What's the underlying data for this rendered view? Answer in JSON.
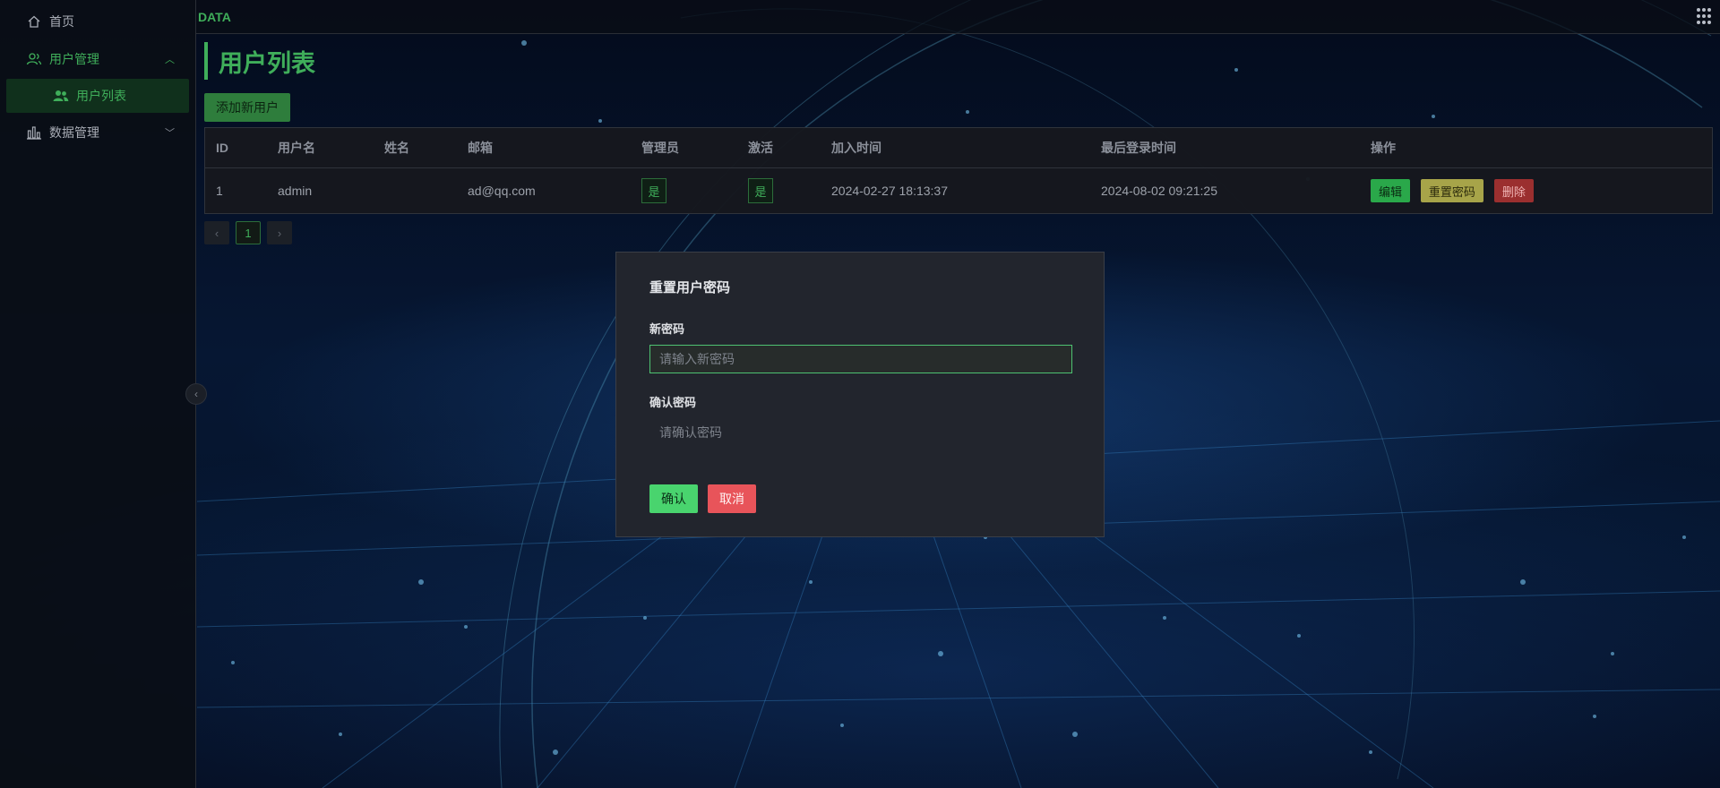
{
  "brand": "DATA",
  "sidebar": {
    "items": [
      {
        "label": "首页",
        "icon": "home-icon"
      },
      {
        "label": "用户管理",
        "icon": "user-group-icon",
        "expanded": true,
        "children": [
          {
            "label": "用户列表",
            "icon": "users-icon",
            "active": true
          }
        ]
      },
      {
        "label": "数据管理",
        "icon": "bar-chart-icon",
        "expanded": false
      }
    ]
  },
  "page": {
    "title": "用户列表",
    "add_button": "添加新用户"
  },
  "table": {
    "headers": [
      "ID",
      "用户名",
      "姓名",
      "邮箱",
      "管理员",
      "激活",
      "加入时间",
      "最后登录时间",
      "操作"
    ],
    "rows": [
      {
        "id": "1",
        "username": "admin",
        "name": "",
        "email": "ad@qq.com",
        "admin": "是",
        "active": "是",
        "joined": "2024-02-27 18:13:37",
        "last_login": "2024-08-02 09:21:25",
        "actions": {
          "edit": "编辑",
          "reset": "重置密码",
          "delete": "删除"
        }
      }
    ]
  },
  "pagination": {
    "prev": "‹",
    "current": "1",
    "next": "›"
  },
  "modal": {
    "title": "重置用户密码",
    "new_password_label": "新密码",
    "new_password_placeholder": "请输入新密码",
    "confirm_password_label": "确认密码",
    "confirm_password_placeholder": "请确认密码",
    "confirm_button": "确认",
    "cancel_button": "取消"
  },
  "colors": {
    "accent": "#3fae5a",
    "confirm": "#49d46e",
    "cancel": "#e8545a",
    "reset": "#a7a449",
    "delete": "#9b2f2f"
  }
}
